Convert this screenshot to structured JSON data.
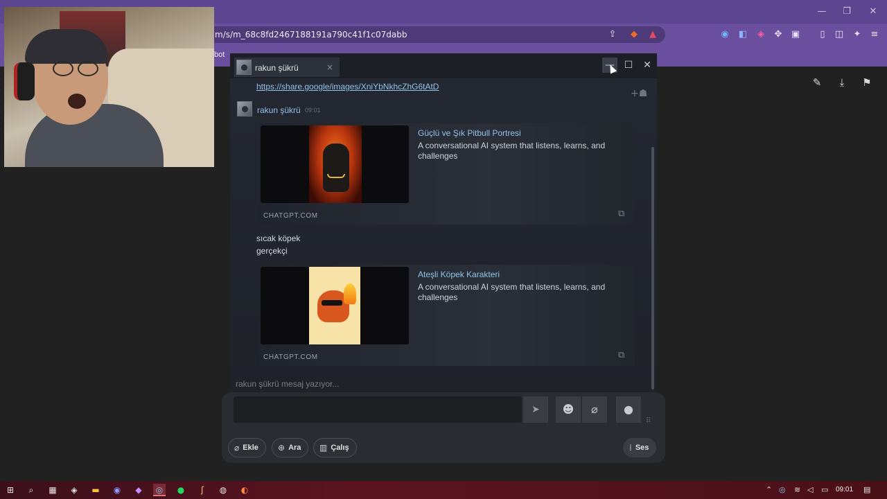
{
  "browser": {
    "url": "m/s/m_68c8fd2467188191a790c41f1c07dabb",
    "bookmark_fragment": "bot"
  },
  "chat": {
    "header": {
      "contact_name": "rakun şükrü",
      "close_glyph": "×",
      "minimize_glyph": "—",
      "maximize_glyph": "☐",
      "window_close_glyph": "✕"
    },
    "previous_link": "https://share.google/images/XniYbNkhcZhG6tAtD",
    "message_sender": "rakun şükrü",
    "message_time": "09:01",
    "embeds": [
      {
        "title": "Güçlü ve Şık Pitbull Portresi",
        "description": "A conversational AI system that listens, learns, and challenges",
        "site": "CHATGPT.COM"
      },
      {
        "title": "Ateşli Köpek Karakteri",
        "description": "A conversational AI system that listens, learns, and challenges",
        "site": "CHATGPT.COM"
      }
    ],
    "text_lines": [
      "sıcak köpek",
      "gerçekçi"
    ],
    "typing_status": "rakun şükrü mesaj yazıyor..."
  },
  "composer": {
    "pills": {
      "ekle": "Ekle",
      "ara": "Ara",
      "calis": "Çalış",
      "ses": "Ses"
    }
  },
  "taskbar": {
    "time": "09:01"
  },
  "colors": {
    "accent_link": "#8fc4ea",
    "browser_purple": "#6a4f9e",
    "taskbar_red": "#5a1420"
  }
}
